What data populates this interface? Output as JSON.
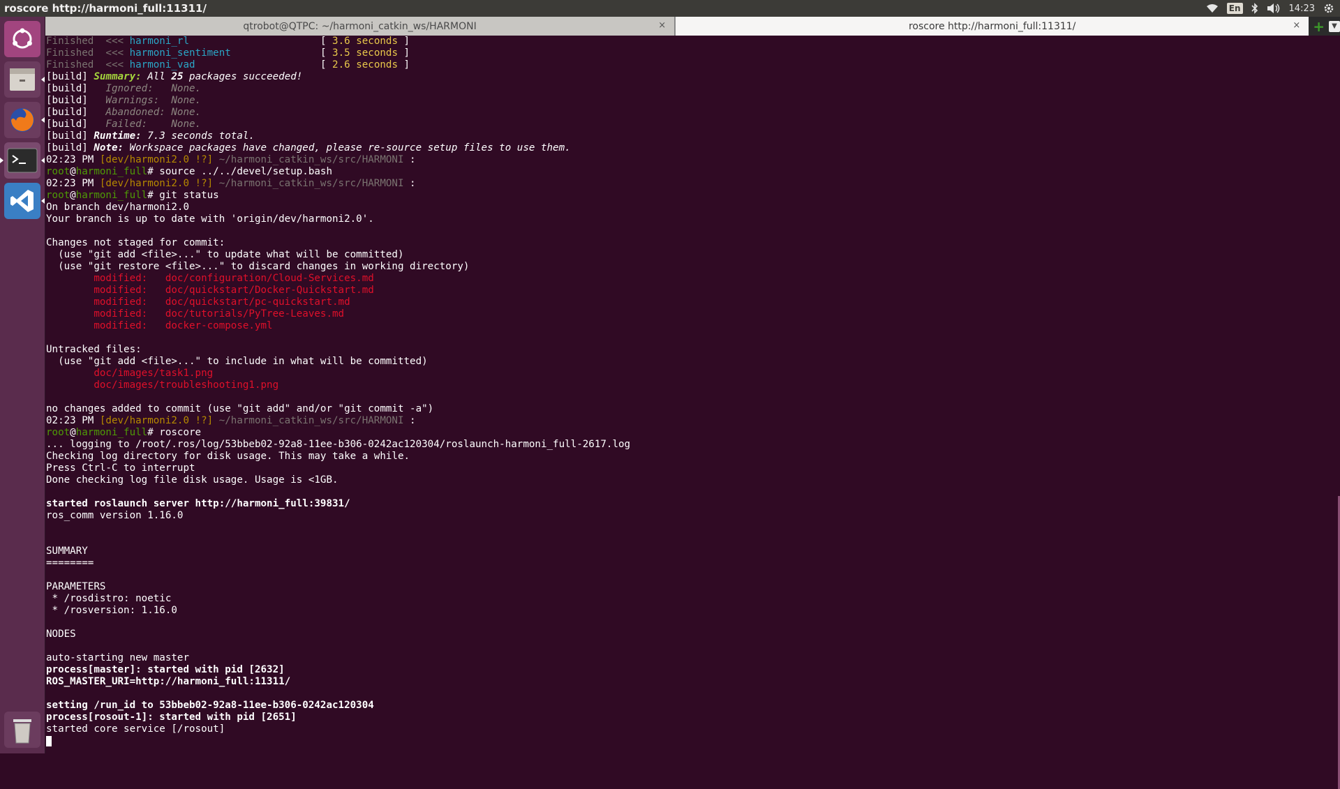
{
  "top_panel": {
    "window_title": "roscore http://harmoni_full:11311/",
    "keyboard_layout": "En",
    "clock": "14:23",
    "icons": [
      "wifi-icon",
      "bluetooth-icon",
      "volume-icon",
      "settings-gear-icon"
    ]
  },
  "launcher": {
    "items": [
      "ubuntu-dash-icon",
      "file-manager-icon",
      "firefox-icon",
      "terminal-icon",
      "vscode-icon",
      "trash-icon"
    ]
  },
  "tabs": [
    {
      "label": "qtrobot@QTPC: ~/harmoni_catkin_ws/HARMONI",
      "active": false
    },
    {
      "label": "roscore http://harmoni_full:11311/",
      "active": true
    }
  ],
  "terminal": {
    "lines": [
      [
        [
          "Finished  ",
          "gray"
        ],
        [
          "<<< ",
          "gray"
        ],
        [
          "harmoni_rl",
          "cyan"
        ],
        [
          "                      ",
          ""
        ],
        [
          "[ ",
          ""
        ],
        [
          "3.6 seconds",
          "yellow"
        ],
        [
          " ]",
          ""
        ]
      ],
      [
        [
          "Finished  ",
          "gray"
        ],
        [
          "<<< ",
          "gray"
        ],
        [
          "harmoni_sentiment",
          "cyan"
        ],
        [
          "               ",
          ""
        ],
        [
          "[ ",
          ""
        ],
        [
          "3.5 seconds",
          "yellow"
        ],
        [
          " ]",
          ""
        ]
      ],
      [
        [
          "Finished  ",
          "gray"
        ],
        [
          "<<< ",
          "gray"
        ],
        [
          "harmoni_vad",
          "cyan"
        ],
        [
          "                     ",
          ""
        ],
        [
          "[ ",
          ""
        ],
        [
          "2.6 seconds",
          "yellow"
        ],
        [
          " ]",
          ""
        ]
      ],
      [
        [
          "[build] ",
          ""
        ],
        [
          "Summary:",
          "ygreen"
        ],
        [
          " All ",
          "it"
        ],
        [
          "25",
          "it b"
        ],
        [
          " packages succeeded!",
          "it"
        ]
      ],
      [
        [
          "[build] ",
          ""
        ],
        [
          "  Ignored:   None.",
          "ital-gray"
        ]
      ],
      [
        [
          "[build] ",
          ""
        ],
        [
          "  Warnings:  None.",
          "ital-gray"
        ]
      ],
      [
        [
          "[build] ",
          ""
        ],
        [
          "  Abandoned: None.",
          "ital-gray"
        ]
      ],
      [
        [
          "[build] ",
          ""
        ],
        [
          "  Failed:    None.",
          "ital-gray"
        ]
      ],
      [
        [
          "[build] ",
          ""
        ],
        [
          "Runtime:",
          "it b"
        ],
        [
          " 7.3 seconds total.",
          "it"
        ]
      ],
      [
        [
          "[build] ",
          ""
        ],
        [
          "Note:",
          "it b"
        ],
        [
          " Workspace packages have changed, please re-source setup files to use them.",
          "it"
        ]
      ],
      [
        [
          "02:23 PM ",
          ""
        ],
        [
          "[dev/harmoni2.0 !?]",
          "olive"
        ],
        [
          " ~/harmoni_catkin_ws/src/HARMONI",
          "gray"
        ],
        [
          " :",
          ""
        ]
      ],
      [
        [
          "root",
          "grn"
        ],
        [
          "@",
          ""
        ],
        [
          "harmoni_full",
          "grn"
        ],
        [
          "# source ../../devel/setup.bash",
          ""
        ]
      ],
      [
        [
          "02:23 PM ",
          ""
        ],
        [
          "[dev/harmoni2.0 !?]",
          "olive"
        ],
        [
          " ~/harmoni_catkin_ws/src/HARMONI",
          "gray"
        ],
        [
          " :",
          ""
        ]
      ],
      [
        [
          "root",
          "grn"
        ],
        [
          "@",
          ""
        ],
        [
          "harmoni_full",
          "grn"
        ],
        [
          "# git status",
          ""
        ]
      ],
      [
        [
          "On branch dev/harmoni2.0",
          ""
        ]
      ],
      [
        [
          "Your branch is up to date with 'origin/dev/harmoni2.0'.",
          ""
        ]
      ],
      [
        [
          "",
          ""
        ]
      ],
      [
        [
          "Changes not staged for commit:",
          ""
        ]
      ],
      [
        [
          "  (use \"git add <file>...\" to update what will be committed)",
          ""
        ]
      ],
      [
        [
          "  (use \"git restore <file>...\" to discard changes in working directory)",
          ""
        ]
      ],
      [
        [
          "        modified:   doc/configuration/Cloud-Services.md",
          "red"
        ]
      ],
      [
        [
          "        modified:   doc/quickstart/Docker-Quickstart.md",
          "red"
        ]
      ],
      [
        [
          "        modified:   doc/quickstart/pc-quickstart.md",
          "red"
        ]
      ],
      [
        [
          "        modified:   doc/tutorials/PyTree-Leaves.md",
          "red"
        ]
      ],
      [
        [
          "        modified:   docker-compose.yml",
          "red"
        ]
      ],
      [
        [
          "",
          ""
        ]
      ],
      [
        [
          "Untracked files:",
          ""
        ]
      ],
      [
        [
          "  (use \"git add <file>...\" to include in what will be committed)",
          ""
        ]
      ],
      [
        [
          "        doc/images/task1.png",
          "red"
        ]
      ],
      [
        [
          "        doc/images/troubleshooting1.png",
          "red"
        ]
      ],
      [
        [
          "",
          ""
        ]
      ],
      [
        [
          "no changes added to commit (use \"git add\" and/or \"git commit -a\")",
          ""
        ]
      ],
      [
        [
          "02:23 PM ",
          ""
        ],
        [
          "[dev/harmoni2.0 !?]",
          "olive"
        ],
        [
          " ~/harmoni_catkin_ws/src/HARMONI",
          "gray"
        ],
        [
          " :",
          ""
        ]
      ],
      [
        [
          "root",
          "grn"
        ],
        [
          "@",
          ""
        ],
        [
          "harmoni_full",
          "grn"
        ],
        [
          "# roscore",
          ""
        ]
      ],
      [
        [
          "... logging to /root/.ros/log/53bbeb02-92a8-11ee-b306-0242ac120304/roslaunch-harmoni_full-2617.log",
          ""
        ]
      ],
      [
        [
          "Checking log directory for disk usage. This may take a while.",
          ""
        ]
      ],
      [
        [
          "Press Ctrl-C to interrupt",
          ""
        ]
      ],
      [
        [
          "Done checking log file disk usage. Usage is <1GB.",
          ""
        ]
      ],
      [
        [
          "",
          ""
        ]
      ],
      [
        [
          "started roslaunch server http://harmoni_full:39831/",
          "b"
        ]
      ],
      [
        [
          "ros_comm version 1.16.0",
          ""
        ]
      ],
      [
        [
          "",
          ""
        ]
      ],
      [
        [
          "",
          ""
        ]
      ],
      [
        [
          "SUMMARY",
          ""
        ]
      ],
      [
        [
          "========",
          ""
        ]
      ],
      [
        [
          "",
          ""
        ]
      ],
      [
        [
          "PARAMETERS",
          ""
        ]
      ],
      [
        [
          " * /rosdistro: noetic",
          ""
        ]
      ],
      [
        [
          " * /rosversion: 1.16.0",
          ""
        ]
      ],
      [
        [
          "",
          ""
        ]
      ],
      [
        [
          "NODES",
          ""
        ]
      ],
      [
        [
          "",
          ""
        ]
      ],
      [
        [
          "auto-starting new master",
          ""
        ]
      ],
      [
        [
          "process[master]: started with pid [2632]",
          "b"
        ]
      ],
      [
        [
          "ROS_MASTER_URI=http://harmoni_full:11311/",
          "b"
        ]
      ],
      [
        [
          "",
          ""
        ]
      ],
      [
        [
          "setting /run_id to 53bbeb02-92a8-11ee-b306-0242ac120304",
          "b"
        ]
      ],
      [
        [
          "process[rosout-1]: started with pid [2651]",
          "b"
        ]
      ],
      [
        [
          "started core service [/rosout]",
          ""
        ]
      ]
    ]
  }
}
